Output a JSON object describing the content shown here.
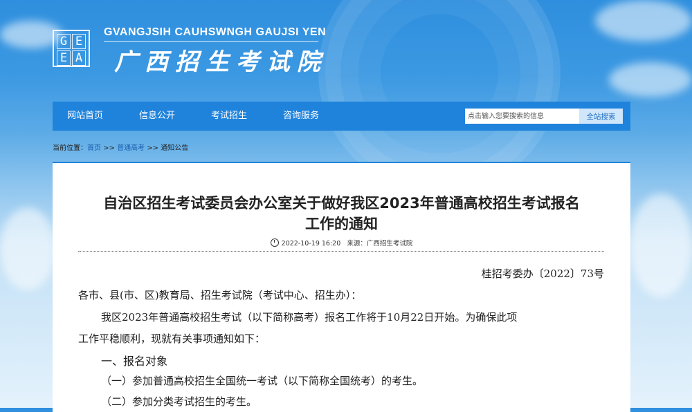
{
  "header": {
    "logo_letters": [
      "G",
      "E",
      "E",
      "A"
    ],
    "site_name_en": "GVANGJSIH CAUHSWNGH GAUJSI YEN",
    "site_name_cn": "广西招生考试院"
  },
  "nav": {
    "items": [
      {
        "label": "网站首页"
      },
      {
        "label": "信息公开"
      },
      {
        "label": "考试招生"
      },
      {
        "label": "咨询服务"
      }
    ],
    "search": {
      "placeholder": "点击输入您要搜索的信息",
      "button": "全站搜索"
    }
  },
  "breadcrumb": {
    "prefix": "当前位置：",
    "home": "首页",
    "sep1": " >> ",
    "section": "普通高考",
    "sep2": " >> ",
    "current": "通知公告"
  },
  "article": {
    "title_line1": "自治区招生考试委员会办公室关于做好我区2023年普通高校招生考试报名",
    "title_line2": "工作的通知",
    "date": "2022-10-19 16:20",
    "source": "来源：广西招生考试院",
    "doc_number": "桂招考委办〔2022〕73号",
    "recipient": "各市、县(市、区)教育局、招生考试院（考试中心、招生办）：",
    "para1_line1": "我区2023年普通高校招生考试（以下简称高考）报名工作将于10月22日开始。为确保此项",
    "para1_line2": "工作平稳顺利，现就有关事项通知如下：",
    "section1_title": "一、报名对象",
    "item1": "（一）参加普通高校招生全国统一考试（以下简称全国统考）的考生。",
    "item2": "（二）参加分类考试招生的考生。"
  },
  "colors": {
    "nav_bg": "#1f83dc",
    "link": "#1a5fb0"
  }
}
